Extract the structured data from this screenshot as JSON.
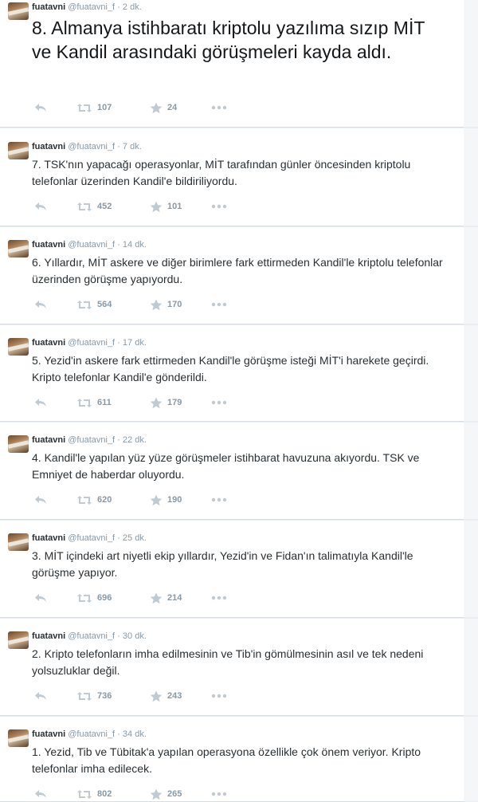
{
  "tweets": [
    {
      "name": "fuatavni",
      "handle": "@fuatavni_f",
      "time": "2 dk.",
      "text": "8. Almanya istihbaratı kriptolu yazılıma sızıp MİT ve Kandil arasındaki görüşmeleri kayda aldı.",
      "retweets": "107",
      "favorites": "24",
      "featured": true
    },
    {
      "name": "fuatavni",
      "handle": "@fuatavni_f",
      "time": "7 dk.",
      "text": "7. TSK'nın yapacağı operasyonlar, MİT tarafından günler öncesinden kriptolu telefonlar üzerinden Kandil'e bildiriliyordu.",
      "retweets": "452",
      "favorites": "101"
    },
    {
      "name": "fuatavni",
      "handle": "@fuatavni_f",
      "time": "14 dk.",
      "text": "6. Yıllardır, MİT askere ve diğer birimlere fark ettirmeden Kandil'le kriptolu telefonlar üzerinden görüşme yapıyordu.",
      "retweets": "564",
      "favorites": "170"
    },
    {
      "name": "fuatavni",
      "handle": "@fuatavni_f",
      "time": "17 dk.",
      "text": "5. Yezid'in askere fark ettirmeden Kandil'le görüşme isteği MİT'i harekete geçirdi. Kripto telefonlar Kandil'e gönderildi.",
      "retweets": "611",
      "favorites": "179"
    },
    {
      "name": "fuatavni",
      "handle": "@fuatavni_f",
      "time": "22 dk.",
      "text": "4. Kandil'le yapılan yüz yüze görüşmeler istihbarat havuzuna akıyordu. TSK ve Emniyet de haberdar oluyordu.",
      "retweets": "620",
      "favorites": "190"
    },
    {
      "name": "fuatavni",
      "handle": "@fuatavni_f",
      "time": "25 dk.",
      "text": "3. MİT içindeki art niyetli ekip yıllardır, Yezid'in ve Fidan'ın talimatıyla Kandil'le görüşme yapıyor.",
      "retweets": "696",
      "favorites": "214"
    },
    {
      "name": "fuatavni",
      "handle": "@fuatavni_f",
      "time": "30 dk.",
      "text": "2. Kripto telefonların imha edilmesinin ve Tib'in gömülmesinin asıl ve tek nedeni yolsuzluklar değil.",
      "retweets": "736",
      "favorites": "243"
    },
    {
      "name": "fuatavni",
      "handle": "@fuatavni_f",
      "time": "34 dk.",
      "text": "1. Yezid, Tib ve Tübitak'a yapılan operasyona özellikle çok önem veriyor. Kripto telefonlar imha edilecek.",
      "retweets": "802",
      "favorites": "265"
    }
  ]
}
